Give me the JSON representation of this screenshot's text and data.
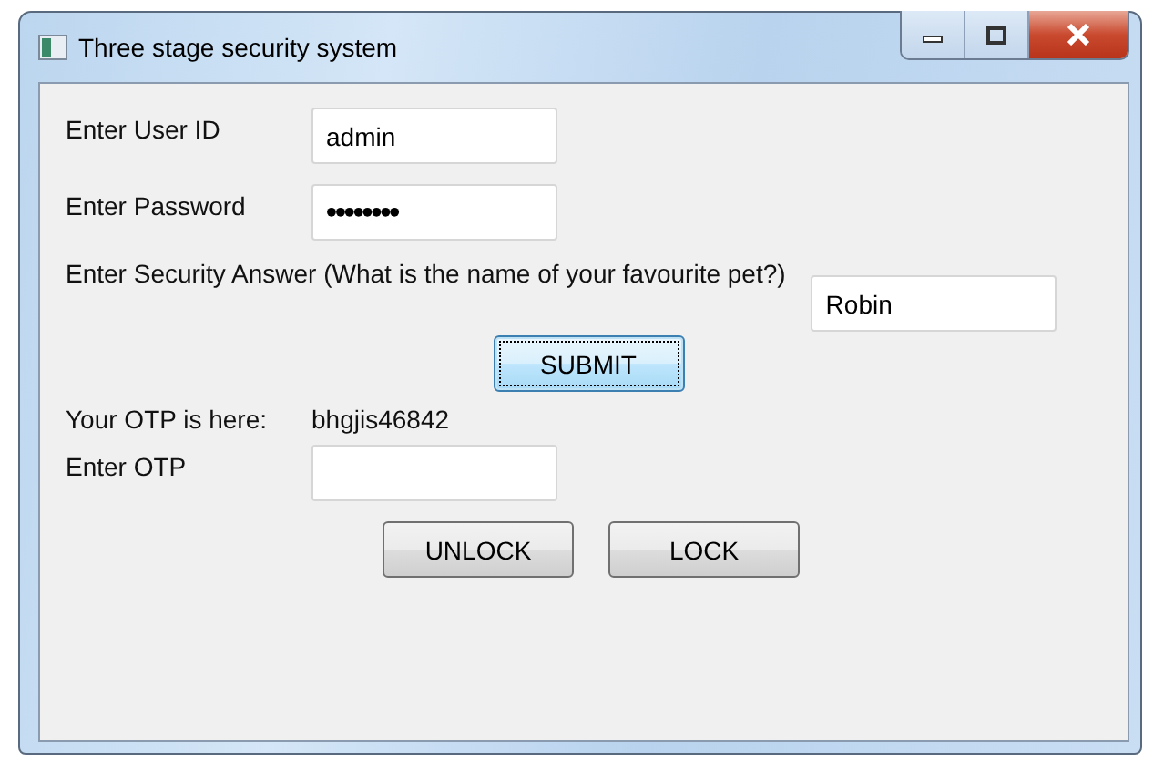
{
  "window": {
    "title": "Three stage security system"
  },
  "fields": [
    {
      "label": "Enter User ID",
      "value": "admin"
    },
    {
      "label": "Enter Password",
      "value": "••••••••"
    }
  ],
  "security": {
    "label": "Enter Security Answer (What is the name of your favourite pet?)",
    "value": "Robin"
  },
  "submit": {
    "label": "SUBMIT",
    "focused": true
  },
  "otp": {
    "label": "Your OTP is here:",
    "value": "bhgjis46842"
  },
  "otp_field": {
    "label": "Enter OTP"
  },
  "buttons": [
    {
      "label": "UNLOCK"
    },
    {
      "label": "LOCK"
    }
  ]
}
